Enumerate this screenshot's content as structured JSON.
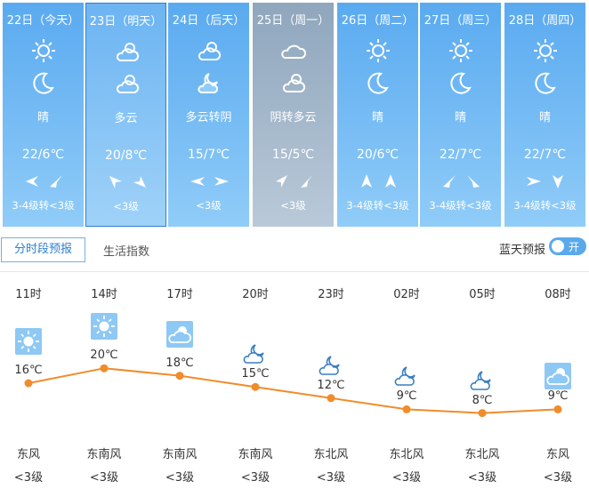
{
  "days": [
    {
      "date": "22日（今天）",
      "icon_day": "sun-icon",
      "icon_night": "moon-icon",
      "weather": "晴",
      "temp": "22/6℃",
      "wind": "3-4级转<3级"
    },
    {
      "date": "23日（明天）",
      "icon_day": "cloudy-icon",
      "icon_night": "cloudy-icon",
      "weather": "多云",
      "temp": "20/8℃",
      "wind": "<3级"
    },
    {
      "date": "24日（后天）",
      "icon_day": "cloudy-icon",
      "icon_night": "cloudy-night-icon",
      "weather": "多云转阴",
      "temp": "15/7℃",
      "wind": "<3级"
    },
    {
      "date": "25日（周一）",
      "icon_day": "cloud-icon",
      "icon_night": "cloudy-icon",
      "weather": "阴转多云",
      "temp": "15/5℃",
      "wind": "<3级"
    },
    {
      "date": "26日（周二）",
      "icon_day": "sun-icon",
      "icon_night": "moon-icon",
      "weather": "晴",
      "temp": "20/6℃",
      "wind": "3-4级转<3级"
    },
    {
      "date": "27日（周三）",
      "icon_day": "sun-icon",
      "icon_night": "moon-icon",
      "weather": "晴",
      "temp": "22/7℃",
      "wind": "3-4级转<3级"
    },
    {
      "date": "28日（周四）",
      "icon_day": "sun-icon",
      "icon_night": "moon-icon",
      "weather": "晴",
      "temp": "22/7℃",
      "wind": "3-4级转<3级"
    }
  ],
  "tabs": {
    "hourly": "分时段预报",
    "life": "生活指数"
  },
  "bluesky": {
    "label": "蓝天预报",
    "toggle": "开"
  },
  "hourly": [
    {
      "time": "11时",
      "temp": "16℃",
      "wind": "东风",
      "level": "<3级",
      "icon": "sun-icon"
    },
    {
      "time": "14时",
      "temp": "20℃",
      "wind": "东南风",
      "level": "<3级",
      "icon": "sun-icon"
    },
    {
      "time": "17时",
      "temp": "18℃",
      "wind": "东南风",
      "level": "<3级",
      "icon": "cloudy-icon"
    },
    {
      "time": "20时",
      "temp": "15℃",
      "wind": "东南风",
      "level": "<3级",
      "icon": "cloudy-night-icon"
    },
    {
      "time": "23时",
      "temp": "12℃",
      "wind": "东北风",
      "level": "<3级",
      "icon": "cloudy-night-icon"
    },
    {
      "time": "02时",
      "temp": "9℃",
      "wind": "东北风",
      "level": "<3级",
      "icon": "cloudy-night-icon"
    },
    {
      "time": "05时",
      "temp": "8℃",
      "wind": "东北风",
      "level": "<3级",
      "icon": "cloudy-night-icon"
    },
    {
      "time": "08时",
      "temp": "9℃",
      "wind": "东风",
      "level": "<3级",
      "icon": "cloudy-icon"
    }
  ],
  "chart_data": {
    "type": "line",
    "x": [
      "11时",
      "14时",
      "17时",
      "20时",
      "23时",
      "02时",
      "05时",
      "08时"
    ],
    "values": [
      16,
      20,
      18,
      15,
      12,
      9,
      8,
      9
    ],
    "color": "#f08c2a"
  }
}
